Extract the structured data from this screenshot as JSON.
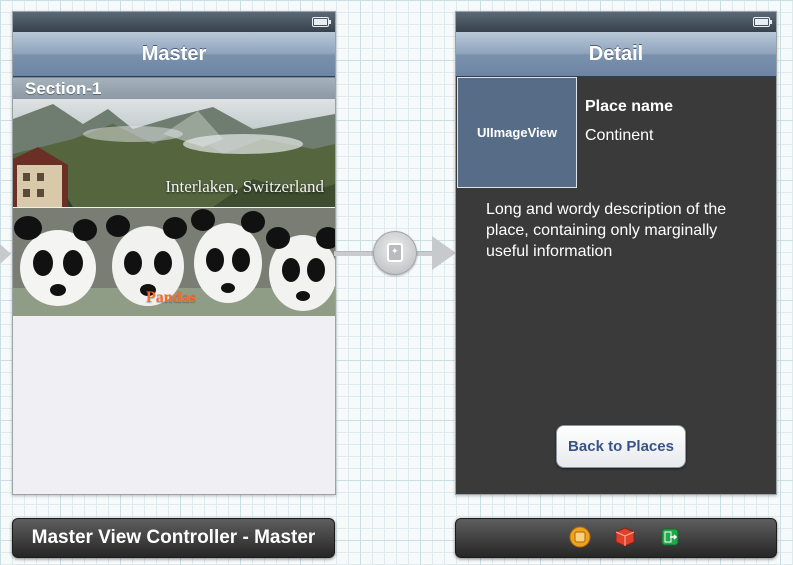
{
  "master": {
    "nav_title": "Master",
    "section_header": "Section-1",
    "cells": [
      {
        "caption": "Interlaken, Switzerland"
      },
      {
        "caption": "Pandas"
      }
    ],
    "dock_label": "Master View Controller - Master"
  },
  "detail": {
    "nav_title": "Detail",
    "image_view_label": "UIImageView",
    "place_name": "Place name",
    "continent": "Continent",
    "description": "Long and wordy description of the place, containing only marginally useful information",
    "back_button": "Back to Places"
  },
  "colors": {
    "pandas_caption": "#ff6a23",
    "image_view_bg": "#566c87",
    "detail_bg": "#3a3a3a",
    "back_button_text": "#385487"
  },
  "icons": [
    "battery-icon",
    "segue-icon",
    "first-responder-icon",
    "object-cube-icon",
    "exit-icon"
  ]
}
